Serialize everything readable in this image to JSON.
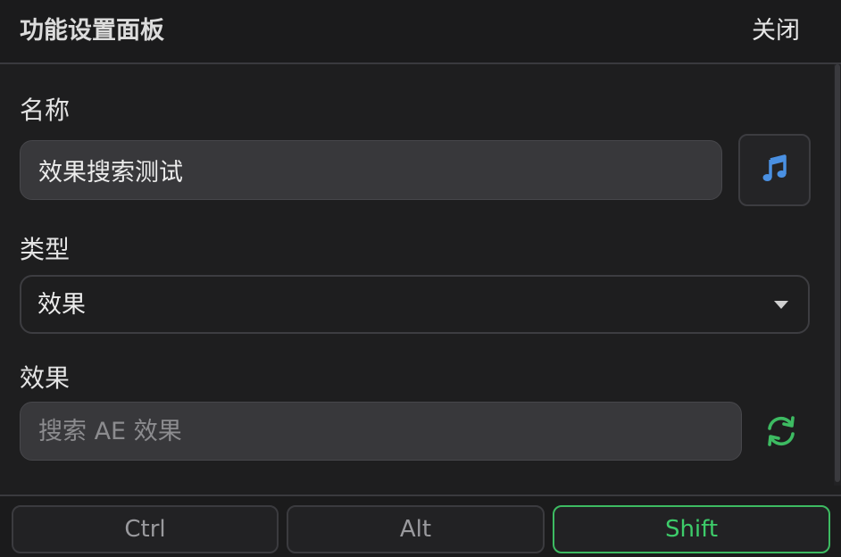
{
  "header": {
    "title": "功能设置面板",
    "close_label": "关闭"
  },
  "form": {
    "name": {
      "label": "名称",
      "value": "效果搜索测试",
      "icon": "music-note-icon"
    },
    "type": {
      "label": "类型",
      "selected": "效果"
    },
    "effect": {
      "label": "效果",
      "placeholder": "搜索 AE 效果",
      "value": "",
      "icon": "refresh-icon"
    }
  },
  "modifiers": [
    {
      "label": "Ctrl",
      "active": false
    },
    {
      "label": "Alt",
      "active": false
    },
    {
      "label": "Shift",
      "active": true
    }
  ],
  "colors": {
    "accent_blue": "#4a90e2",
    "accent_green": "#3dbb62",
    "background": "#1e1e1f",
    "input_background": "#38383b"
  }
}
